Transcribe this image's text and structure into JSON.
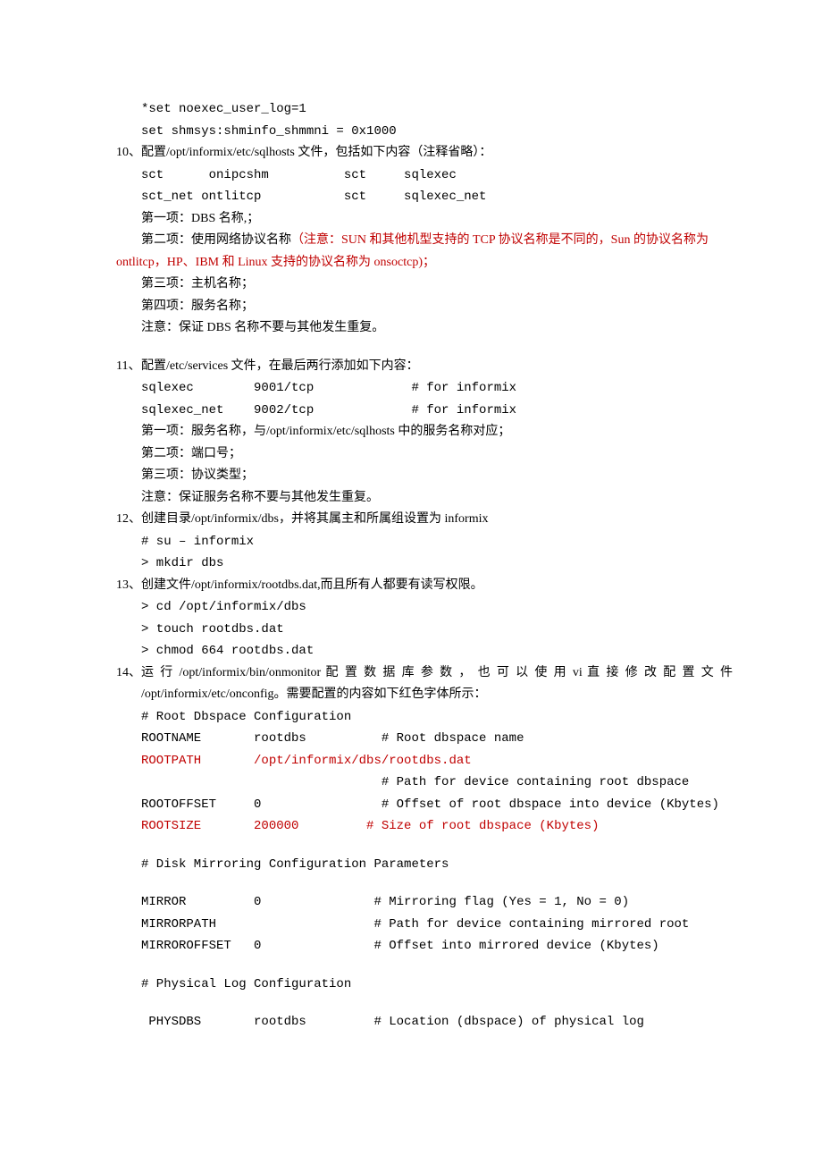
{
  "pre": {
    "l1": "*set noexec_user_log=1",
    "l2": "set shmsys:shminfo_shmmni = 0x1000"
  },
  "s10": {
    "num": "10、",
    "title": "配置/opt/informix/etc/sqlhosts 文件，包括如下内容（注释省略）：",
    "line1": "sct      onipcshm          sct     sqlexec",
    "line2": "sct_net ontlitcp           sct     sqlexec_net",
    "item1": "第一项：DBS 名称,；",
    "item2a": "第二项：使用网络协议名称",
    "item2b": "（注意：SUN 和其他机型支持的 TCP 协议名称是不同的，Sun 的协议名称为",
    "item2c": "ontlitcp，HP、IBM 和 Linux 支持的协议名称为 onsoctcp)；",
    "item3": "第三项：主机名称；",
    "item4": "第四项：服务名称；",
    "note": "注意：保证 DBS 名称不要与其他发生重复。"
  },
  "s11": {
    "num": "11、",
    "title": "配置/etc/services 文件，在最后两行添加如下内容：",
    "line1": "sqlexec        9001/tcp             # for informix",
    "line2": "sqlexec_net    9002/tcp             # for informix",
    "item1": "第一项：服务名称，与/opt/informix/etc/sqlhosts 中的服务名称对应；",
    "item2": "第二项：端口号；",
    "item3": "第三项：协议类型；",
    "note": "注意：保证服务名称不要与其他发生重复。"
  },
  "s12": {
    "num": "12、",
    "title": "创建目录/opt/informix/dbs，并将其属主和所属组设置为 informix",
    "line1": "# su – informix",
    "line2": "> mkdir dbs"
  },
  "s13": {
    "num": "13、",
    "title": "创建文件/opt/informix/rootdbs.dat,而且所有人都要有读写权限。",
    "line1": "> cd /opt/informix/dbs",
    "line2": "> touch rootdbs.dat",
    "line3": "> chmod 664 rootdbs.dat"
  },
  "s14": {
    "num": "14、",
    "title1": "运 行 /opt/informix/bin/onmonitor 配 置 数 据 库 参 数 ， 也 可 以 使 用 vi 直 接 修 改 配 置 文 件",
    "title2": "/opt/informix/etc/onconfig。需要配置的内容如下红色字体所示：",
    "c1": "# Root Dbspace Configuration",
    "r1": "ROOTNAME       rootdbs          # Root dbspace name",
    "r2": "ROOTPATH       /opt/informix/dbs/rootdbs.dat",
    "r2b": "                                # Path for device containing root dbspace",
    "r3": "ROOTOFFSET     0                # Offset of root dbspace into device (Kbytes)",
    "r4": "ROOTSIZE       200000         # Size of root dbspace (Kbytes)",
    "c2": "# Disk Mirroring Configuration Parameters",
    "m1": "MIRROR         0               # Mirroring flag (Yes = 1, No = 0)",
    "m2": "MIRRORPATH                     # Path for device containing mirrored root",
    "m3": "MIRROROFFSET   0               # Offset into mirrored device (Kbytes)",
    "c3": "# Physical Log Configuration",
    "p1": " PHYSDBS       rootdbs         # Location (dbspace) of physical log"
  }
}
